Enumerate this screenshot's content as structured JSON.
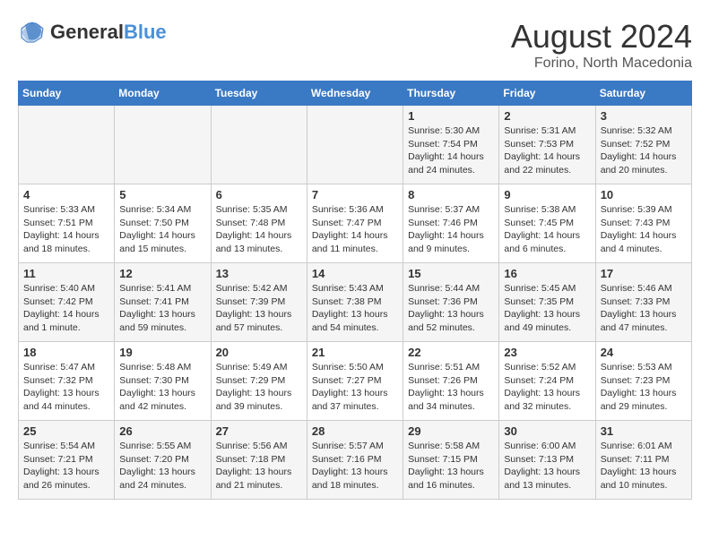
{
  "header": {
    "logo_general": "General",
    "logo_blue": "Blue",
    "month_year": "August 2024",
    "location": "Forino, North Macedonia"
  },
  "days_of_week": [
    "Sunday",
    "Monday",
    "Tuesday",
    "Wednesday",
    "Thursday",
    "Friday",
    "Saturday"
  ],
  "weeks": [
    [
      {
        "day": "",
        "info": ""
      },
      {
        "day": "",
        "info": ""
      },
      {
        "day": "",
        "info": ""
      },
      {
        "day": "",
        "info": ""
      },
      {
        "day": "1",
        "info": "Sunrise: 5:30 AM\nSunset: 7:54 PM\nDaylight: 14 hours\nand 24 minutes."
      },
      {
        "day": "2",
        "info": "Sunrise: 5:31 AM\nSunset: 7:53 PM\nDaylight: 14 hours\nand 22 minutes."
      },
      {
        "day": "3",
        "info": "Sunrise: 5:32 AM\nSunset: 7:52 PM\nDaylight: 14 hours\nand 20 minutes."
      }
    ],
    [
      {
        "day": "4",
        "info": "Sunrise: 5:33 AM\nSunset: 7:51 PM\nDaylight: 14 hours\nand 18 minutes."
      },
      {
        "day": "5",
        "info": "Sunrise: 5:34 AM\nSunset: 7:50 PM\nDaylight: 14 hours\nand 15 minutes."
      },
      {
        "day": "6",
        "info": "Sunrise: 5:35 AM\nSunset: 7:48 PM\nDaylight: 14 hours\nand 13 minutes."
      },
      {
        "day": "7",
        "info": "Sunrise: 5:36 AM\nSunset: 7:47 PM\nDaylight: 14 hours\nand 11 minutes."
      },
      {
        "day": "8",
        "info": "Sunrise: 5:37 AM\nSunset: 7:46 PM\nDaylight: 14 hours\nand 9 minutes."
      },
      {
        "day": "9",
        "info": "Sunrise: 5:38 AM\nSunset: 7:45 PM\nDaylight: 14 hours\nand 6 minutes."
      },
      {
        "day": "10",
        "info": "Sunrise: 5:39 AM\nSunset: 7:43 PM\nDaylight: 14 hours\nand 4 minutes."
      }
    ],
    [
      {
        "day": "11",
        "info": "Sunrise: 5:40 AM\nSunset: 7:42 PM\nDaylight: 14 hours\nand 1 minute."
      },
      {
        "day": "12",
        "info": "Sunrise: 5:41 AM\nSunset: 7:41 PM\nDaylight: 13 hours\nand 59 minutes."
      },
      {
        "day": "13",
        "info": "Sunrise: 5:42 AM\nSunset: 7:39 PM\nDaylight: 13 hours\nand 57 minutes."
      },
      {
        "day": "14",
        "info": "Sunrise: 5:43 AM\nSunset: 7:38 PM\nDaylight: 13 hours\nand 54 minutes."
      },
      {
        "day": "15",
        "info": "Sunrise: 5:44 AM\nSunset: 7:36 PM\nDaylight: 13 hours\nand 52 minutes."
      },
      {
        "day": "16",
        "info": "Sunrise: 5:45 AM\nSunset: 7:35 PM\nDaylight: 13 hours\nand 49 minutes."
      },
      {
        "day": "17",
        "info": "Sunrise: 5:46 AM\nSunset: 7:33 PM\nDaylight: 13 hours\nand 47 minutes."
      }
    ],
    [
      {
        "day": "18",
        "info": "Sunrise: 5:47 AM\nSunset: 7:32 PM\nDaylight: 13 hours\nand 44 minutes."
      },
      {
        "day": "19",
        "info": "Sunrise: 5:48 AM\nSunset: 7:30 PM\nDaylight: 13 hours\nand 42 minutes."
      },
      {
        "day": "20",
        "info": "Sunrise: 5:49 AM\nSunset: 7:29 PM\nDaylight: 13 hours\nand 39 minutes."
      },
      {
        "day": "21",
        "info": "Sunrise: 5:50 AM\nSunset: 7:27 PM\nDaylight: 13 hours\nand 37 minutes."
      },
      {
        "day": "22",
        "info": "Sunrise: 5:51 AM\nSunset: 7:26 PM\nDaylight: 13 hours\nand 34 minutes."
      },
      {
        "day": "23",
        "info": "Sunrise: 5:52 AM\nSunset: 7:24 PM\nDaylight: 13 hours\nand 32 minutes."
      },
      {
        "day": "24",
        "info": "Sunrise: 5:53 AM\nSunset: 7:23 PM\nDaylight: 13 hours\nand 29 minutes."
      }
    ],
    [
      {
        "day": "25",
        "info": "Sunrise: 5:54 AM\nSunset: 7:21 PM\nDaylight: 13 hours\nand 26 minutes."
      },
      {
        "day": "26",
        "info": "Sunrise: 5:55 AM\nSunset: 7:20 PM\nDaylight: 13 hours\nand 24 minutes."
      },
      {
        "day": "27",
        "info": "Sunrise: 5:56 AM\nSunset: 7:18 PM\nDaylight: 13 hours\nand 21 minutes."
      },
      {
        "day": "28",
        "info": "Sunrise: 5:57 AM\nSunset: 7:16 PM\nDaylight: 13 hours\nand 18 minutes."
      },
      {
        "day": "29",
        "info": "Sunrise: 5:58 AM\nSunset: 7:15 PM\nDaylight: 13 hours\nand 16 minutes."
      },
      {
        "day": "30",
        "info": "Sunrise: 6:00 AM\nSunset: 7:13 PM\nDaylight: 13 hours\nand 13 minutes."
      },
      {
        "day": "31",
        "info": "Sunrise: 6:01 AM\nSunset: 7:11 PM\nDaylight: 13 hours\nand 10 minutes."
      }
    ]
  ]
}
